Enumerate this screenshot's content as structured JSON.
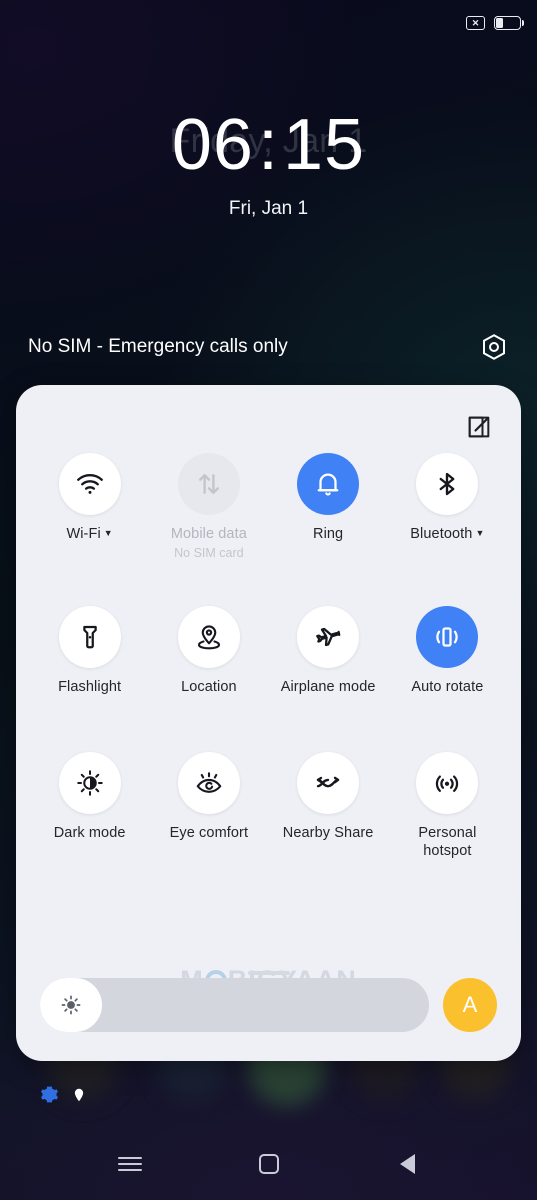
{
  "statusbar": {
    "nosim_icon": "sim-x-icon",
    "nosim_glyph": "✕",
    "battery_icon": "battery-icon",
    "battery_level_percent": 30
  },
  "lockscreen": {
    "ghost_date": "Friday, Jan 1",
    "time_hours": "06",
    "time_separator": ":",
    "time_minutes": "15",
    "date": "Fri, Jan 1",
    "carrier_text": "No SIM - Emergency calls only",
    "settings_icon": "hexagon-settings-icon"
  },
  "quick_settings": {
    "edit_icon": "edit-pencil-square-icon",
    "accent_color": "#4081F5",
    "panel_color": "#EEF0F5",
    "tiles": [
      {
        "label": "Wi-Fi",
        "icon": "wifi-icon",
        "state": "on",
        "has_caret": true,
        "sublabel": ""
      },
      {
        "label": "Mobile data",
        "icon": "data-arrows-icon",
        "state": "disabled",
        "has_caret": false,
        "sublabel": "No SIM card"
      },
      {
        "label": "Ring",
        "icon": "bell-icon",
        "state": "active",
        "has_caret": false,
        "sublabel": ""
      },
      {
        "label": "Bluetooth",
        "icon": "bluetooth-icon",
        "state": "on",
        "has_caret": true,
        "sublabel": ""
      },
      {
        "label": "Flashlight",
        "icon": "flashlight-icon",
        "state": "on",
        "has_caret": false,
        "sublabel": ""
      },
      {
        "label": "Location",
        "icon": "location-pin-icon",
        "state": "on",
        "has_caret": false,
        "sublabel": ""
      },
      {
        "label": "Airplane mode",
        "icon": "airplane-icon",
        "state": "on",
        "has_caret": false,
        "sublabel": ""
      },
      {
        "label": "Auto rotate",
        "icon": "auto-rotate-icon",
        "state": "active",
        "has_caret": false,
        "sublabel": ""
      },
      {
        "label": "Dark mode",
        "icon": "dark-mode-icon",
        "state": "on",
        "has_caret": false,
        "sublabel": ""
      },
      {
        "label": "Eye comfort",
        "icon": "eye-comfort-icon",
        "state": "on",
        "has_caret": false,
        "sublabel": ""
      },
      {
        "label": "Nearby Share",
        "icon": "nearby-share-icon",
        "state": "on",
        "has_caret": false,
        "sublabel": ""
      },
      {
        "label": "Personal\nhotspot",
        "icon": "hotspot-icon",
        "state": "on",
        "has_caret": false,
        "sublabel": ""
      }
    ],
    "brightness": {
      "icon": "brightness-sun-icon",
      "value_percent": 16,
      "auto_label": "A",
      "auto_color": "#FBC02D"
    }
  },
  "watermark": {
    "text_before": "M",
    "text_after": "BIGYAAN"
  },
  "notification_icons": [
    {
      "name": "settings-gear-icon",
      "color": "#2f6fe0"
    },
    {
      "name": "location-pin-icon",
      "color": "#ffffff"
    }
  ],
  "navbar": {
    "recents": "recents-icon",
    "home": "home-icon",
    "back": "back-icon"
  }
}
